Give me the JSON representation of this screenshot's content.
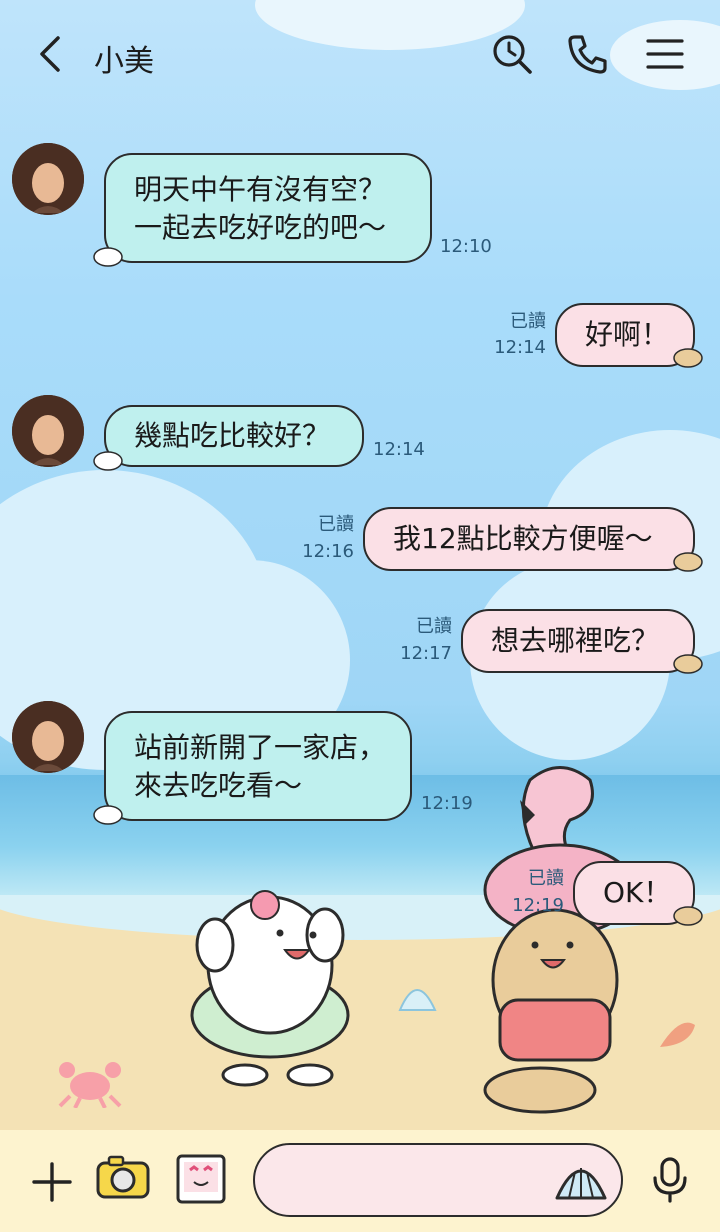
{
  "header": {
    "title": "小美"
  },
  "messages": [
    {
      "side": "in",
      "text": "明天中午有沒有空？\n一起去吃好吃的吧～",
      "time": "12:10"
    },
    {
      "side": "out",
      "text": "好啊！",
      "time": "12:14",
      "read": "已讀"
    },
    {
      "side": "in",
      "text": "幾點吃比較好？",
      "time": "12:14"
    },
    {
      "side": "out",
      "text": "我12點比較方便喔～",
      "time": "12:16",
      "read": "已讀"
    },
    {
      "side": "out",
      "text": "想去哪裡吃？",
      "time": "12:17",
      "read": "已讀"
    },
    {
      "side": "in",
      "text": "站前新開了一家店，\n來去吃吃看～",
      "time": "12:19"
    },
    {
      "side": "out",
      "text": "OK！",
      "time": "12:19",
      "read": "已讀"
    }
  ],
  "input": {
    "placeholder": ""
  },
  "icons": {
    "back": "chevron-left-icon",
    "search": "search-clock-icon",
    "call": "phone-icon",
    "menu": "hamburger-menu-icon",
    "add": "plus-icon",
    "camera": "camera-icon",
    "photo": "photo-sticker-icon",
    "sticker": "shell-sticker-icon",
    "mic": "microphone-icon"
  },
  "colors": {
    "incoming_bubble": "#bff0ee",
    "outgoing_bubble": "#fbe0e6",
    "bottom_bar": "#fdf3cf"
  }
}
